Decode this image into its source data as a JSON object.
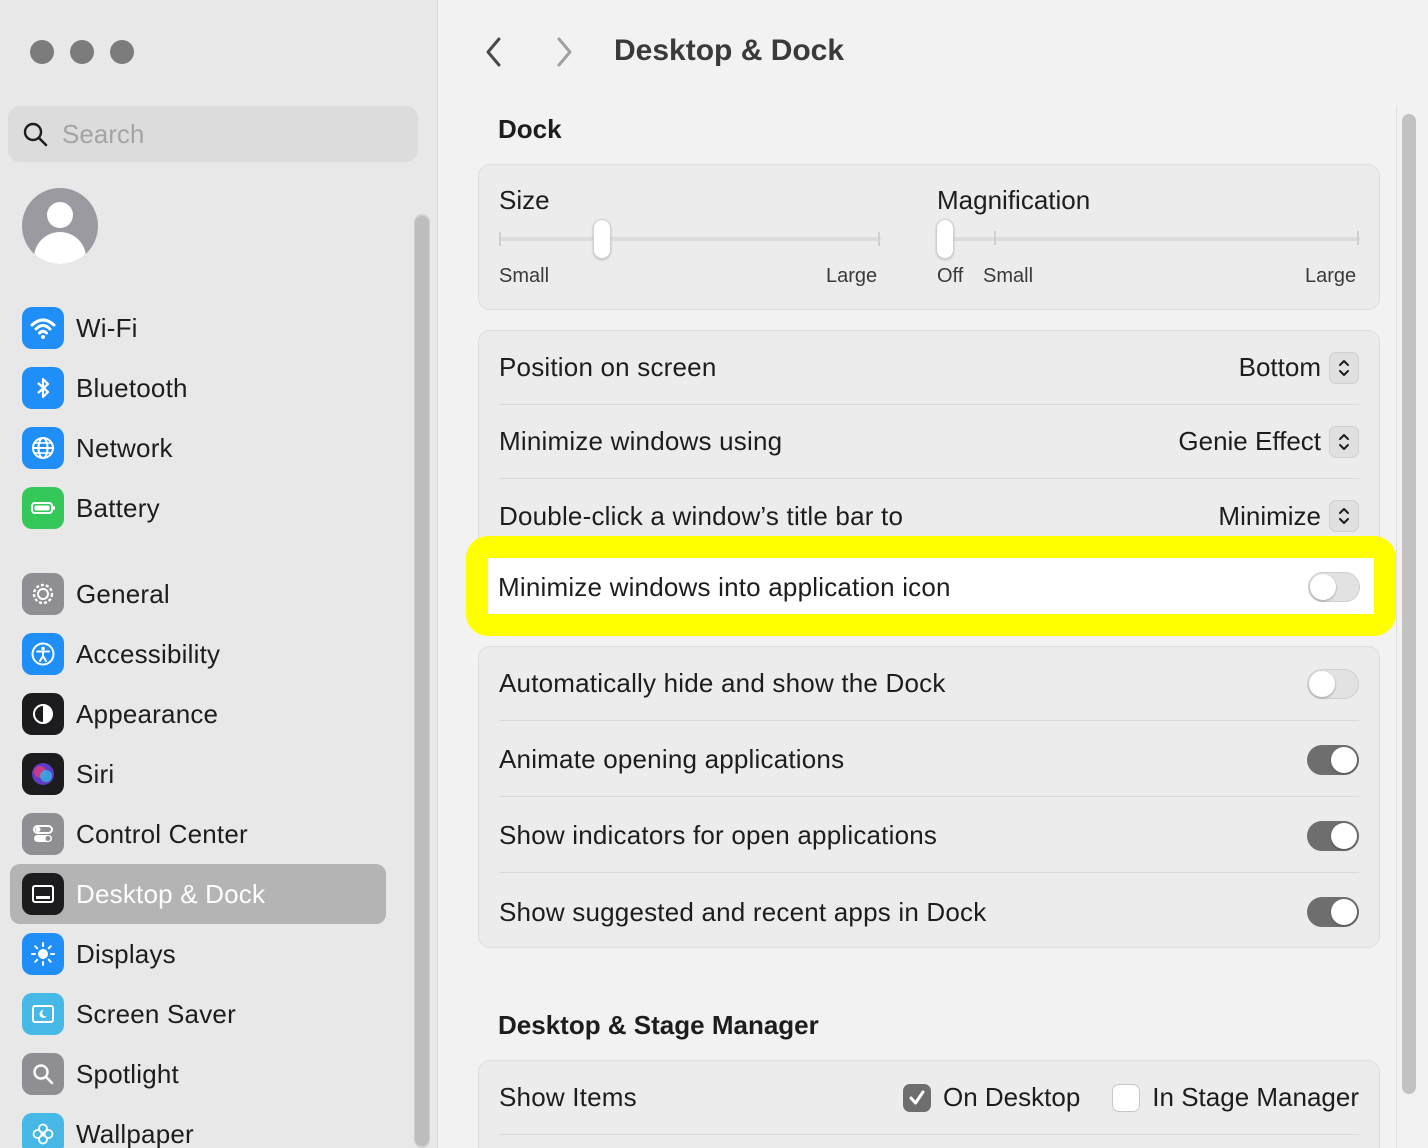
{
  "window": {
    "title": "Desktop & Dock"
  },
  "sidebar": {
    "search_placeholder": "Search",
    "items": [
      {
        "label": "Wi-Fi",
        "icon": "wifi-icon",
        "color": "#1f8ff7"
      },
      {
        "label": "Bluetooth",
        "icon": "bluetooth-icon",
        "color": "#1f8ff7"
      },
      {
        "label": "Network",
        "icon": "globe-icon",
        "color": "#1f8ff7"
      },
      {
        "label": "Battery",
        "icon": "battery-icon",
        "color": "#34c759"
      },
      {
        "label": "General",
        "icon": "gear-icon",
        "color": "#8e8e93"
      },
      {
        "label": "Accessibility",
        "icon": "accessibility-icon",
        "color": "#1f8ff7"
      },
      {
        "label": "Appearance",
        "icon": "appearance-icon",
        "color": "#1c1c1e"
      },
      {
        "label": "Siri",
        "icon": "siri-icon",
        "color": "#5e3cc4"
      },
      {
        "label": "Control Center",
        "icon": "control-center-icon",
        "color": "#8e8e93"
      },
      {
        "label": "Desktop & Dock",
        "icon": "dock-icon",
        "color": "#1c1c1e",
        "selected": true
      },
      {
        "label": "Displays",
        "icon": "sun-icon",
        "color": "#1f8ff7"
      },
      {
        "label": "Screen Saver",
        "icon": "screen-saver-icon",
        "color": "#45b8e6"
      },
      {
        "label": "Spotlight",
        "icon": "spotlight-icon",
        "color": "#8e8e93"
      },
      {
        "label": "Wallpaper",
        "icon": "flower-icon",
        "color": "#45b8e6"
      }
    ]
  },
  "main": {
    "dock_section": "Dock",
    "size": {
      "title": "Size",
      "min": "Small",
      "max": "Large",
      "value": 0.27
    },
    "magnification": {
      "title": "Magnification",
      "off": "Off",
      "min": "Small",
      "max": "Large",
      "value": 0.0
    },
    "position": {
      "label": "Position on screen",
      "value": "Bottom"
    },
    "minimize_using": {
      "label": "Minimize windows using",
      "value": "Genie Effect"
    },
    "double_click": {
      "label": "Double-click a window’s title bar to",
      "value": "Minimize"
    },
    "minimize_into_icon": {
      "label": "Minimize windows into application icon",
      "on": false
    },
    "toggles": [
      {
        "label": "Automatically hide and show the Dock",
        "on": false
      },
      {
        "label": "Animate opening applications",
        "on": true
      },
      {
        "label": "Show indicators for open applications",
        "on": true
      },
      {
        "label": "Show suggested and recent apps in Dock",
        "on": true
      }
    ],
    "stage_section": "Desktop & Stage Manager",
    "show_items": {
      "label": "Show Items",
      "on_desktop": "On Desktop",
      "on_desktop_checked": true,
      "stage_manager": "In Stage Manager",
      "stage_manager_checked": false
    }
  },
  "colors": {
    "highlight": "#ffff00",
    "toggle_on": "#6e6e6e",
    "selected_row": "#b4b4b4"
  }
}
